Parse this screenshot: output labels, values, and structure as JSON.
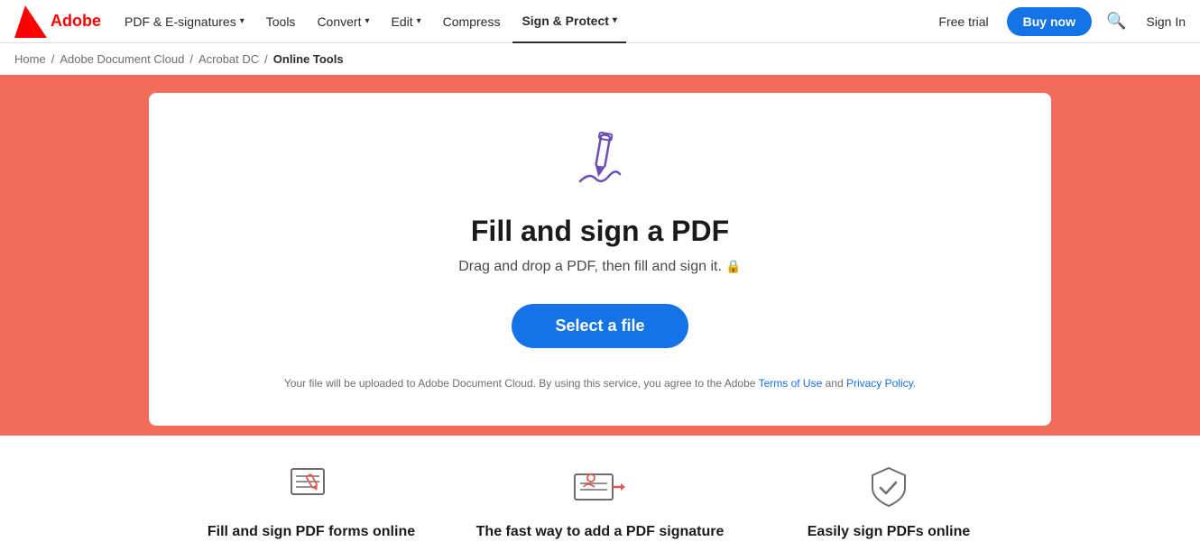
{
  "nav": {
    "logo_alt": "Adobe",
    "items": [
      {
        "label": "PDF & E-signatures",
        "has_chevron": true,
        "active": false
      },
      {
        "label": "Tools",
        "has_chevron": false,
        "active": false
      },
      {
        "label": "Convert",
        "has_chevron": true,
        "active": false
      },
      {
        "label": "Edit",
        "has_chevron": true,
        "active": false
      },
      {
        "label": "Compress",
        "has_chevron": false,
        "active": false
      },
      {
        "label": "Sign & Protect",
        "has_chevron": true,
        "active": true
      }
    ],
    "free_trial": "Free trial",
    "buy_now": "Buy now",
    "sign_in": "Sign In"
  },
  "breadcrumb": {
    "items": [
      {
        "label": "Home",
        "link": true
      },
      {
        "label": "Adobe Document Cloud",
        "link": true
      },
      {
        "label": "Acrobat DC",
        "link": true
      },
      {
        "label": "Online Tools",
        "link": false
      }
    ]
  },
  "card": {
    "title": "Fill and sign a PDF",
    "subtitle": "Drag and drop a PDF, then fill and sign it.",
    "select_btn": "Select a file",
    "legal_text": "Your file will be uploaded to Adobe Document Cloud.  By using this service, you agree to the Adobe ",
    "terms_label": "Terms of Use",
    "and": " and ",
    "privacy_label": "Privacy Policy",
    "period": "."
  },
  "features": [
    {
      "title": "Fill and sign PDF forms online"
    },
    {
      "title": "The fast way to add a PDF signature"
    },
    {
      "title": "Easily sign PDFs online"
    }
  ]
}
